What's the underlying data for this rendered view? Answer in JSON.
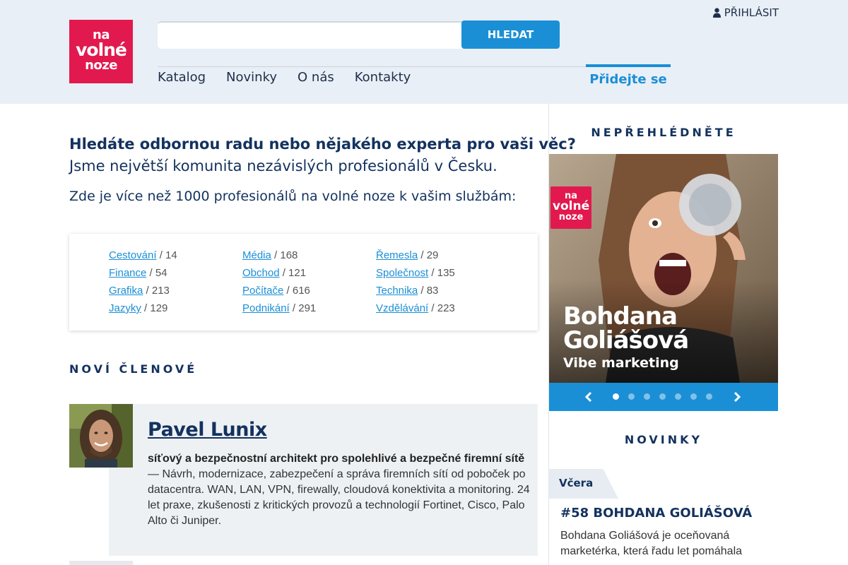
{
  "logo": {
    "line1": "na",
    "line2": "volné",
    "line3": "noze"
  },
  "search": {
    "placeholder": "",
    "button_label": "HLEDAT"
  },
  "login": {
    "label": "PŘIHLÁSIT",
    "icon": "user-icon"
  },
  "nav": {
    "items": [
      {
        "label": "Katalog"
      },
      {
        "label": "Novinky"
      },
      {
        "label": "O nás"
      },
      {
        "label": "Kontakty"
      }
    ],
    "join_label": "Přidejte se"
  },
  "intro": {
    "headline": "Hledáte odbornou radu nebo nějakého experta pro vaši věc?",
    "subheadline": "Jsme největší komunita nezávislých profesionálů v Česku.",
    "count_text": "Zde je více než 1000 profesionálů na volné noze k vašim službám:"
  },
  "categories": {
    "columns": [
      [
        {
          "name": "Cestování",
          "count": " / 14"
        },
        {
          "name": "Finance",
          "count": " / 54"
        },
        {
          "name": "Grafika",
          "count": " / 213"
        },
        {
          "name": "Jazyky",
          "count": " / 129"
        }
      ],
      [
        {
          "name": "Média",
          "count": " / 168"
        },
        {
          "name": "Obchod",
          "count": " / 121"
        },
        {
          "name": "Počítače",
          "count": " / 616"
        },
        {
          "name": "Podnikání",
          "count": " / 291"
        }
      ],
      [
        {
          "name": "Řemesla",
          "count": " / 29"
        },
        {
          "name": "Společnost",
          "count": " / 135"
        },
        {
          "name": "Technika",
          "count": " / 83"
        },
        {
          "name": "Vzdělávání",
          "count": " / 223"
        }
      ]
    ]
  },
  "new_members": {
    "title": "NOVÍ ČLENOVÉ",
    "items": [
      {
        "name": "Pavel Lunix",
        "tagline": "síťový a bezpečnostní architekt pro spolehlivé a bezpečné firemní sítě",
        "description": " — Návrh, modernizace, zabezpečení a správa firemních sítí od poboček po datacentra. WAN, LAN, VPN, firewally, cloudová konektivita a monitoring. 24 let praxe, zkušenosti z kritických provozů a technologií Fortinet, Cisco, Palo Alto či Juniper."
      }
    ]
  },
  "sidebar": {
    "featured_title": "NEPŘEHLÉDNĚTE",
    "slider": {
      "logo": {
        "line1": "na",
        "line2": "volné",
        "line3": "noze"
      },
      "name_line1": "Bohdana",
      "name_line2": "Goliášová",
      "caption": "Vibe marketing",
      "dot_count": 7,
      "active_dot": 0
    },
    "news_title": "NOVINKY",
    "news": {
      "tag": "Včera",
      "headline": "#58 BOHDANA GOLIÁŠOVÁ",
      "text": "Bohdana Goliášová je oceňovaná marketérka, která řadu let pomáhala"
    }
  },
  "colors": {
    "brand_red": "#e2194e",
    "accent_blue": "#1a8fd6",
    "navy": "#13325e",
    "header_bg": "#e9eff6"
  }
}
